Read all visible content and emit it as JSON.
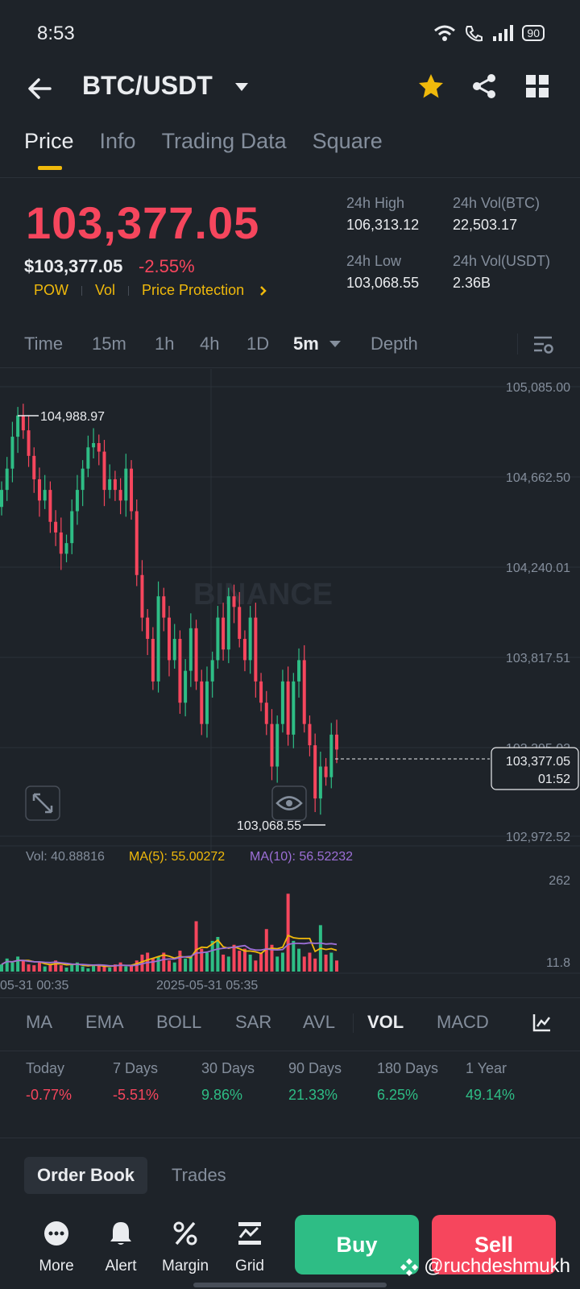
{
  "status_bar": {
    "time": "8:53",
    "battery": "90"
  },
  "header": {
    "pair": "BTC/USDT"
  },
  "tabs": [
    {
      "label": "Price",
      "active": true
    },
    {
      "label": "Info",
      "active": false
    },
    {
      "label": "Trading Data",
      "active": false
    },
    {
      "label": "Square",
      "active": false
    }
  ],
  "price": {
    "last": "103,377.05",
    "usd": "$103,377.05",
    "change": "-2.55%",
    "tags": [
      "POW",
      "Vol",
      "Price Protection"
    ]
  },
  "stats": {
    "high_label": "24h High",
    "high": "106,313.12",
    "low_label": "24h Low",
    "low": "103,068.55",
    "vol_btc_label": "24h Vol(BTC)",
    "vol_btc": "22,503.17",
    "vol_usdt_label": "24h Vol(USDT)",
    "vol_usdt": "2.36B"
  },
  "intervals": {
    "time": "Time",
    "m15": "15m",
    "h1": "1h",
    "h4": "4h",
    "d1": "1D",
    "selected": "5m",
    "depth": "Depth"
  },
  "chart": {
    "watermark": "BINANCE",
    "y_ticks": [
      "105,085.00",
      "104,662.50",
      "104,240.01",
      "103,817.51",
      "103,395.02",
      "102,972.52"
    ],
    "high_marker": "104,988.97",
    "low_marker": "103,068.55",
    "last_price": "103,377.05",
    "countdown": "01:52",
    "vol_label": "Vol: 40.88816",
    "ma5_label": "MA(5): 55.00272",
    "ma10_label": "MA(10): 56.52232",
    "vol_y_top": "262",
    "vol_y_bottom": "11.8",
    "x_ticks": [
      "05-31 00:35",
      "2025-05-31 05:35"
    ],
    "colors": {
      "up": "#2ebd85",
      "down": "#f6465d",
      "ma5": "#f0b90b",
      "ma10": "#9c6fd6"
    }
  },
  "chart_data": {
    "type": "candlestick",
    "price_range": [
      102972.52,
      105085.0
    ],
    "high": 104988.97,
    "low": 103068.55,
    "last": 103377.05,
    "closes": [
      104600,
      104700,
      104850,
      104950,
      104880,
      104760,
      104650,
      104550,
      104600,
      104450,
      104400,
      104300,
      104350,
      104500,
      104600,
      104700,
      104800,
      104820,
      104780,
      104600,
      104650,
      104600,
      104550,
      104700,
      104500,
      104200,
      104000,
      103900,
      103700,
      104100,
      104000,
      103800,
      103900,
      103600,
      103750,
      103950,
      103700,
      103500,
      103700,
      103800,
      104000,
      103850,
      104100,
      104050,
      103900,
      103800,
      104000,
      103700,
      103600,
      103500,
      103300,
      103500,
      103700,
      103450,
      103700,
      103800,
      103500,
      103400,
      103150,
      103300,
      103250,
      103450,
      103380
    ],
    "volume_range": [
      11.8,
      262
    ],
    "volume": [
      30,
      45,
      35,
      50,
      40,
      30,
      28,
      35,
      25,
      30,
      40,
      28,
      22,
      30,
      35,
      25,
      20,
      30,
      28,
      25,
      22,
      30,
      35,
      25,
      28,
      40,
      55,
      60,
      45,
      50,
      60,
      40,
      35,
      65,
      45,
      50,
      140,
      70,
      60,
      90,
      100,
      55,
      50,
      80,
      65,
      70,
      55,
      40,
      60,
      120,
      80,
      50,
      60,
      210,
      90,
      70,
      50,
      60,
      45,
      130,
      55,
      60,
      40
    ]
  },
  "indicators": [
    "MA",
    "EMA",
    "BOLL",
    "SAR",
    "AVL",
    "VOL",
    "MACD"
  ],
  "performance": [
    {
      "label": "Today",
      "value": "-0.77%"
    },
    {
      "label": "7 Days",
      "value": "-5.51%"
    },
    {
      "label": "30 Days",
      "value": "9.86%"
    },
    {
      "label": "90 Days",
      "value": "21.33%"
    },
    {
      "label": "180 Days",
      "value": "6.25%"
    },
    {
      "label": "1 Year",
      "value": "49.14%"
    }
  ],
  "order_tabs": {
    "order_book": "Order Book",
    "trades": "Trades"
  },
  "bottom_bar": {
    "more": "More",
    "alert": "Alert",
    "margin": "Margin",
    "grid": "Grid",
    "buy": "Buy",
    "sell": "Sell"
  },
  "watermark_user": "@ruchdeshmukh"
}
